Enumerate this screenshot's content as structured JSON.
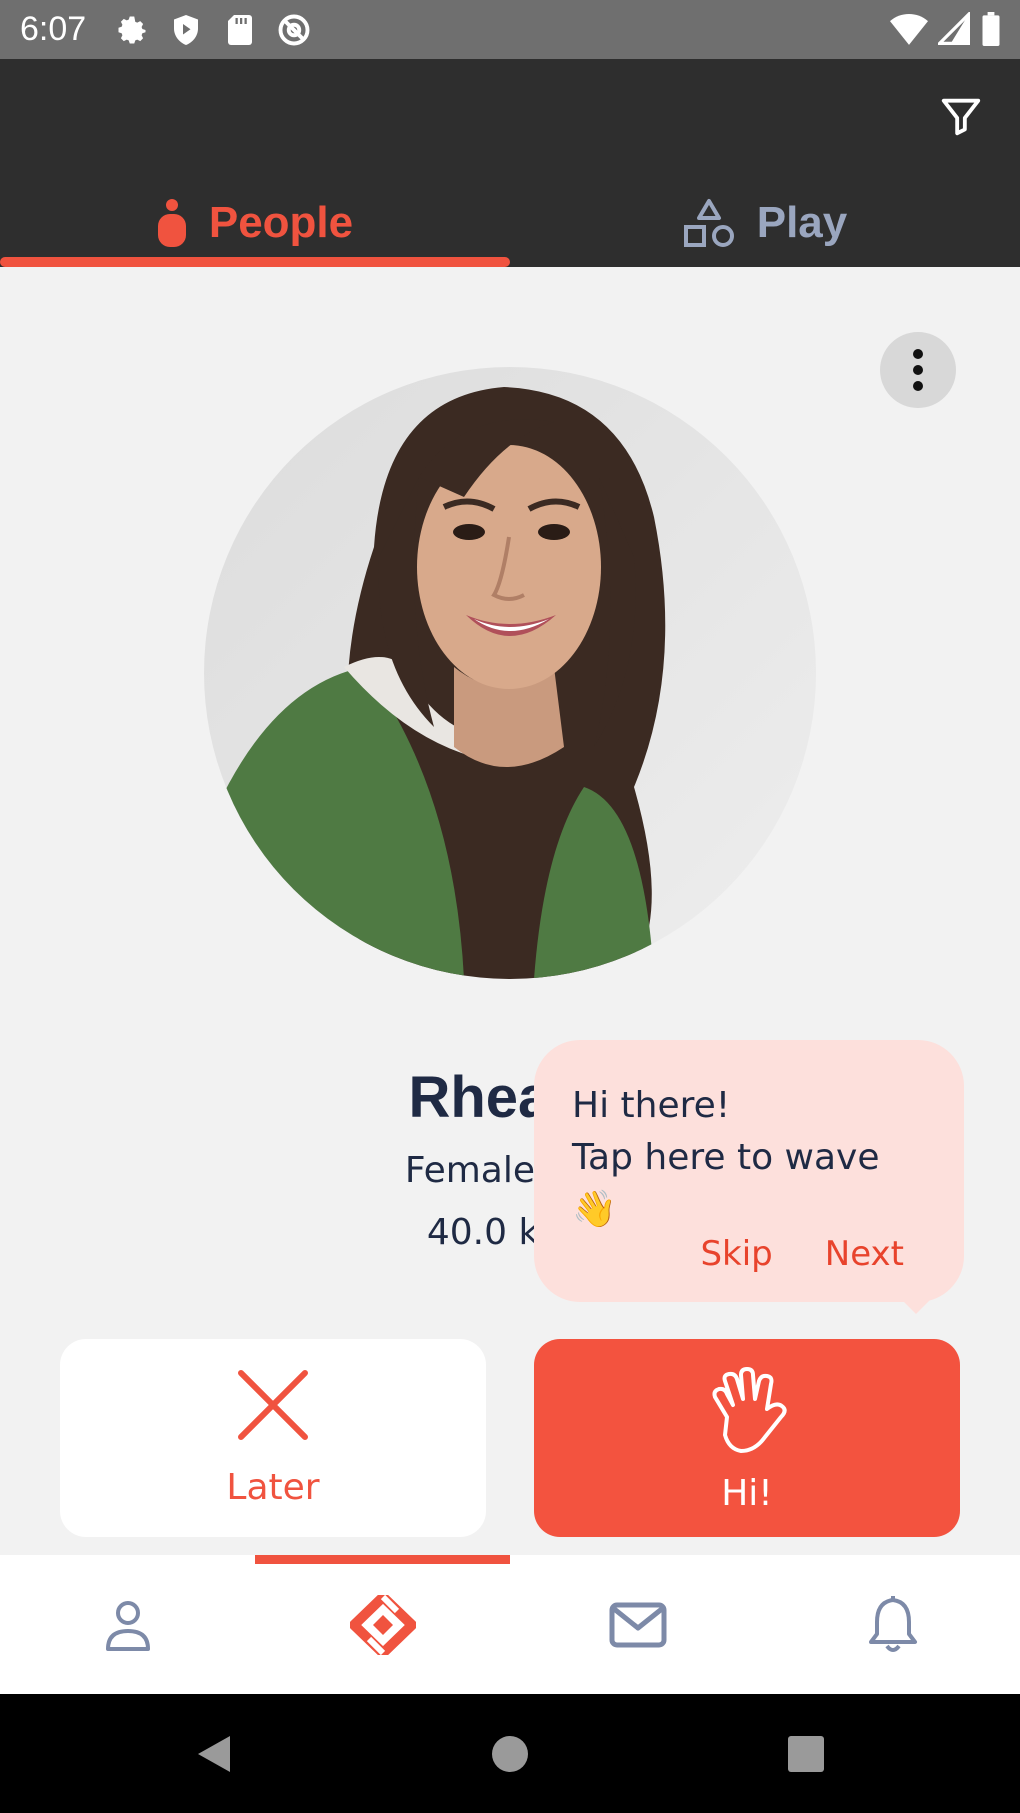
{
  "status_bar": {
    "time": "6:07",
    "left_icons": [
      "settings-icon",
      "shield-play-icon",
      "sd-card-icon",
      "at-sign-icon"
    ],
    "right_icons": [
      "wifi-icon",
      "signal-icon",
      "battery-icon"
    ]
  },
  "header": {
    "filter_icon": "filter-icon",
    "tabs": [
      {
        "label": "People",
        "icon": "person-icon",
        "active": true
      },
      {
        "label": "Play",
        "icon": "shapes-icon",
        "active": false
      }
    ]
  },
  "profile": {
    "name": "Rhea G",
    "details": "Female, 21,",
    "distance": "40.0 kms"
  },
  "tooltip": {
    "title": "Hi there!",
    "body": "Tap here to wave 👋",
    "skip_label": "Skip",
    "next_label": "Next"
  },
  "actions": {
    "later_label": "Later",
    "hi_label": "Hi!"
  },
  "bottom_nav": {
    "items": [
      "profile-icon",
      "discover-icon",
      "messages-icon",
      "notifications-icon"
    ],
    "active_index": 1
  },
  "colors": {
    "accent": "#f0533f",
    "header_bg": "#2e2e2e",
    "tooltip_bg": "#fde0dc",
    "text_dark": "#1f2a44"
  }
}
